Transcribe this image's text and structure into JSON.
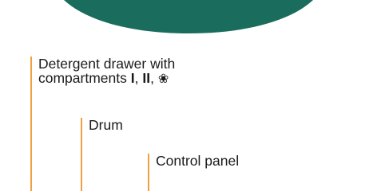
{
  "colors": {
    "drum_green": "#1a6d5d",
    "leader_orange": "#f0a040"
  },
  "labels": {
    "detergent_line1": "Detergent drawer with",
    "detergent_line2_prefix": "compartments ",
    "compartment_1": "I",
    "separator_1": ", ",
    "compartment_2": "II",
    "separator_2": ", ",
    "compartment_3_symbol": "❀",
    "drum": "Drum",
    "control_panel": "Control panel"
  },
  "icons": {
    "compartment_3_symbol": "flower-icon"
  }
}
